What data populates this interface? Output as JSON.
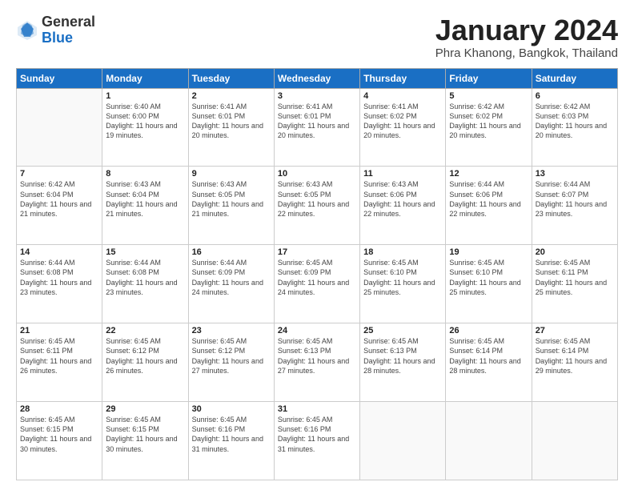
{
  "header": {
    "logo_general": "General",
    "logo_blue": "Blue",
    "title": "January 2024",
    "subtitle": "Phra Khanong, Bangkok, Thailand"
  },
  "weekdays": [
    "Sunday",
    "Monday",
    "Tuesday",
    "Wednesday",
    "Thursday",
    "Friday",
    "Saturday"
  ],
  "weeks": [
    [
      {
        "day": "",
        "sunrise": "",
        "sunset": "",
        "daylight": ""
      },
      {
        "day": "1",
        "sunrise": "Sunrise: 6:40 AM",
        "sunset": "Sunset: 6:00 PM",
        "daylight": "Daylight: 11 hours and 19 minutes."
      },
      {
        "day": "2",
        "sunrise": "Sunrise: 6:41 AM",
        "sunset": "Sunset: 6:01 PM",
        "daylight": "Daylight: 11 hours and 20 minutes."
      },
      {
        "day": "3",
        "sunrise": "Sunrise: 6:41 AM",
        "sunset": "Sunset: 6:01 PM",
        "daylight": "Daylight: 11 hours and 20 minutes."
      },
      {
        "day": "4",
        "sunrise": "Sunrise: 6:41 AM",
        "sunset": "Sunset: 6:02 PM",
        "daylight": "Daylight: 11 hours and 20 minutes."
      },
      {
        "day": "5",
        "sunrise": "Sunrise: 6:42 AM",
        "sunset": "Sunset: 6:02 PM",
        "daylight": "Daylight: 11 hours and 20 minutes."
      },
      {
        "day": "6",
        "sunrise": "Sunrise: 6:42 AM",
        "sunset": "Sunset: 6:03 PM",
        "daylight": "Daylight: 11 hours and 20 minutes."
      }
    ],
    [
      {
        "day": "7",
        "sunrise": "Sunrise: 6:42 AM",
        "sunset": "Sunset: 6:04 PM",
        "daylight": "Daylight: 11 hours and 21 minutes."
      },
      {
        "day": "8",
        "sunrise": "Sunrise: 6:43 AM",
        "sunset": "Sunset: 6:04 PM",
        "daylight": "Daylight: 11 hours and 21 minutes."
      },
      {
        "day": "9",
        "sunrise": "Sunrise: 6:43 AM",
        "sunset": "Sunset: 6:05 PM",
        "daylight": "Daylight: 11 hours and 21 minutes."
      },
      {
        "day": "10",
        "sunrise": "Sunrise: 6:43 AM",
        "sunset": "Sunset: 6:05 PM",
        "daylight": "Daylight: 11 hours and 22 minutes."
      },
      {
        "day": "11",
        "sunrise": "Sunrise: 6:43 AM",
        "sunset": "Sunset: 6:06 PM",
        "daylight": "Daylight: 11 hours and 22 minutes."
      },
      {
        "day": "12",
        "sunrise": "Sunrise: 6:44 AM",
        "sunset": "Sunset: 6:06 PM",
        "daylight": "Daylight: 11 hours and 22 minutes."
      },
      {
        "day": "13",
        "sunrise": "Sunrise: 6:44 AM",
        "sunset": "Sunset: 6:07 PM",
        "daylight": "Daylight: 11 hours and 23 minutes."
      }
    ],
    [
      {
        "day": "14",
        "sunrise": "Sunrise: 6:44 AM",
        "sunset": "Sunset: 6:08 PM",
        "daylight": "Daylight: 11 hours and 23 minutes."
      },
      {
        "day": "15",
        "sunrise": "Sunrise: 6:44 AM",
        "sunset": "Sunset: 6:08 PM",
        "daylight": "Daylight: 11 hours and 23 minutes."
      },
      {
        "day": "16",
        "sunrise": "Sunrise: 6:44 AM",
        "sunset": "Sunset: 6:09 PM",
        "daylight": "Daylight: 11 hours and 24 minutes."
      },
      {
        "day": "17",
        "sunrise": "Sunrise: 6:45 AM",
        "sunset": "Sunset: 6:09 PM",
        "daylight": "Daylight: 11 hours and 24 minutes."
      },
      {
        "day": "18",
        "sunrise": "Sunrise: 6:45 AM",
        "sunset": "Sunset: 6:10 PM",
        "daylight": "Daylight: 11 hours and 25 minutes."
      },
      {
        "day": "19",
        "sunrise": "Sunrise: 6:45 AM",
        "sunset": "Sunset: 6:10 PM",
        "daylight": "Daylight: 11 hours and 25 minutes."
      },
      {
        "day": "20",
        "sunrise": "Sunrise: 6:45 AM",
        "sunset": "Sunset: 6:11 PM",
        "daylight": "Daylight: 11 hours and 25 minutes."
      }
    ],
    [
      {
        "day": "21",
        "sunrise": "Sunrise: 6:45 AM",
        "sunset": "Sunset: 6:11 PM",
        "daylight": "Daylight: 11 hours and 26 minutes."
      },
      {
        "day": "22",
        "sunrise": "Sunrise: 6:45 AM",
        "sunset": "Sunset: 6:12 PM",
        "daylight": "Daylight: 11 hours and 26 minutes."
      },
      {
        "day": "23",
        "sunrise": "Sunrise: 6:45 AM",
        "sunset": "Sunset: 6:12 PM",
        "daylight": "Daylight: 11 hours and 27 minutes."
      },
      {
        "day": "24",
        "sunrise": "Sunrise: 6:45 AM",
        "sunset": "Sunset: 6:13 PM",
        "daylight": "Daylight: 11 hours and 27 minutes."
      },
      {
        "day": "25",
        "sunrise": "Sunrise: 6:45 AM",
        "sunset": "Sunset: 6:13 PM",
        "daylight": "Daylight: 11 hours and 28 minutes."
      },
      {
        "day": "26",
        "sunrise": "Sunrise: 6:45 AM",
        "sunset": "Sunset: 6:14 PM",
        "daylight": "Daylight: 11 hours and 28 minutes."
      },
      {
        "day": "27",
        "sunrise": "Sunrise: 6:45 AM",
        "sunset": "Sunset: 6:14 PM",
        "daylight": "Daylight: 11 hours and 29 minutes."
      }
    ],
    [
      {
        "day": "28",
        "sunrise": "Sunrise: 6:45 AM",
        "sunset": "Sunset: 6:15 PM",
        "daylight": "Daylight: 11 hours and 30 minutes."
      },
      {
        "day": "29",
        "sunrise": "Sunrise: 6:45 AM",
        "sunset": "Sunset: 6:15 PM",
        "daylight": "Daylight: 11 hours and 30 minutes."
      },
      {
        "day": "30",
        "sunrise": "Sunrise: 6:45 AM",
        "sunset": "Sunset: 6:16 PM",
        "daylight": "Daylight: 11 hours and 31 minutes."
      },
      {
        "day": "31",
        "sunrise": "Sunrise: 6:45 AM",
        "sunset": "Sunset: 6:16 PM",
        "daylight": "Daylight: 11 hours and 31 minutes."
      },
      {
        "day": "",
        "sunrise": "",
        "sunset": "",
        "daylight": ""
      },
      {
        "day": "",
        "sunrise": "",
        "sunset": "",
        "daylight": ""
      },
      {
        "day": "",
        "sunrise": "",
        "sunset": "",
        "daylight": ""
      }
    ]
  ]
}
